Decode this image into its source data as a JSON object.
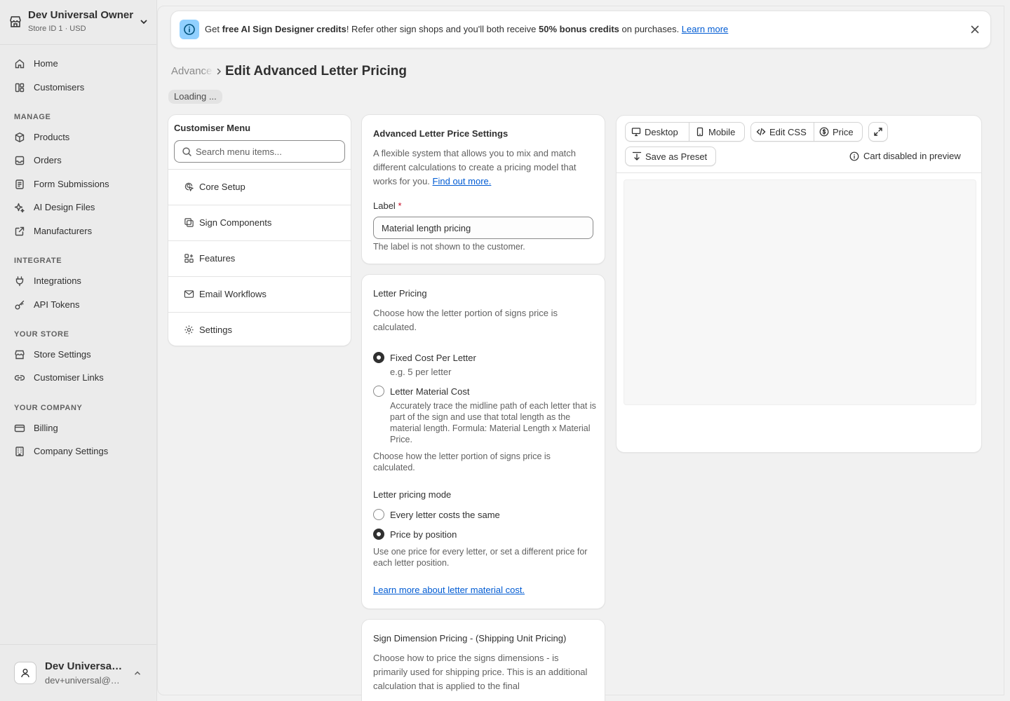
{
  "store": {
    "name": "Dev Universal Owner",
    "sub": "Store ID 1 · USD"
  },
  "nav": {
    "home": "Home",
    "customisers": "Customisers",
    "manage_heading": "MANAGE",
    "products": "Products",
    "orders": "Orders",
    "form_submissions": "Form Submissions",
    "ai_design_files": "AI Design Files",
    "manufacturers": "Manufacturers",
    "integrate_heading": "INTEGRATE",
    "integrations": "Integrations",
    "api_tokens": "API Tokens",
    "your_store_heading": "YOUR STORE",
    "store_settings": "Store Settings",
    "customiser_links": "Customiser Links",
    "your_company_heading": "YOUR COMPANY",
    "billing": "Billing",
    "company_settings": "Company Settings"
  },
  "user": {
    "name": "Dev Universal Owner",
    "email": "dev+universal@example.com"
  },
  "banner": {
    "text_1": "Get ",
    "bold_1": "free AI Sign Designer credits",
    "text_2": "! Refer other sign shops and you'll both receive ",
    "bold_2": "50% bonus credits",
    "text_3": " on purchases. ",
    "link": "Learn more"
  },
  "breadcrumb": {
    "parent": "Advanced Letter Pricing",
    "title": "Edit Advanced Letter Pricing"
  },
  "loading": "Loading ...",
  "menu": {
    "title": "Customiser Menu",
    "search_placeholder": "Search menu items...",
    "items": [
      "Core Setup",
      "Sign Components",
      "Features",
      "Email Workflows",
      "Settings"
    ]
  },
  "settings_card": {
    "title": "Advanced Letter Price Settings",
    "desc_1": "A flexible system that allows you to mix and match different calculations to create a pricing model that works for you.",
    "desc_link": "Find out more.",
    "label": "Label",
    "required_mark": "*",
    "label_value": "Material length pricing",
    "help": "The label is not shown to the customer."
  },
  "letter_card": {
    "title": "Letter Pricing",
    "desc": "Choose how the letter portion of signs price is calculated.",
    "option_fixed": "Fixed Cost Per Letter",
    "option_fixed_hint": "e.g. 5 per letter",
    "option_fixed_checked": true,
    "option_material": "Letter Material Cost",
    "option_material_hint": "Accurately trace the midline path of each letter that is part of the sign and use that total length as the material length. Formula: Material Length x Material Price.",
    "desc_repeat": "Choose how the letter portion of signs price is calculated.",
    "mode_title": "Letter pricing mode",
    "mode_same": "Every letter costs the same",
    "mode_position": "Price by position",
    "mode_position_checked": true,
    "mode_help": "Use one price for every letter, or set a different price for each letter position.",
    "learn_link": "Learn more about letter material cost."
  },
  "dim_card": {
    "title": "Sign Dimension Pricing - (Shipping Unit Pricing)",
    "desc": "Choose how to price the signs dimensions - is primarily used for shipping price. This is an additional calculation that is applied to the final"
  },
  "preview": {
    "desktop": "Desktop",
    "mobile": "Mobile",
    "edit_css": "Edit CSS",
    "price": "Price",
    "save_preset": "Save as Preset",
    "cart_note": "Cart disabled in preview"
  },
  "colors": {
    "accent_link": "#005bd3",
    "banner_icon_bg": "#91d0ff",
    "required": "#c70a24"
  }
}
